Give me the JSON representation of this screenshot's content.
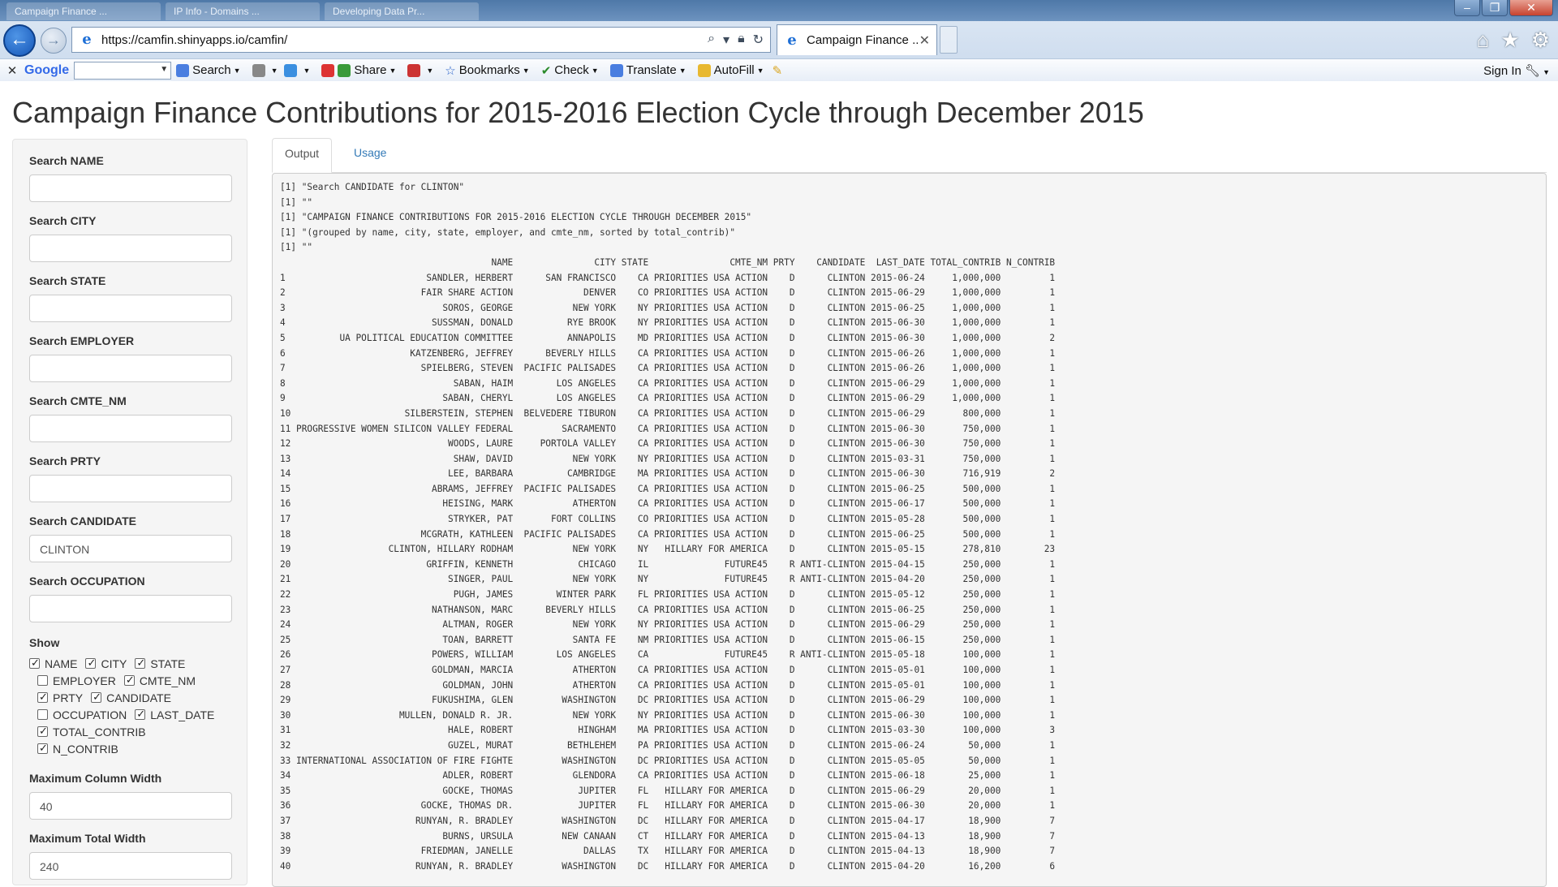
{
  "browser": {
    "bg_tabs": [
      "Campaign Finance ...",
      "IP Info - Domains ...",
      "Developing Data Pr..."
    ],
    "url": "https://camfin.shinyapps.io/camfin/",
    "active_tab_title": "Campaign Finance ...",
    "toolbar": {
      "google": "Google",
      "search": "Search",
      "share": "Share",
      "bookmarks": "Bookmarks",
      "check": "Check",
      "translate": "Translate",
      "autofill": "AutoFill",
      "sign_in": "Sign In"
    }
  },
  "page": {
    "title": "Campaign Finance Contributions for 2015-2016 Election Cycle through December 2015"
  },
  "sidebar": {
    "fields": [
      {
        "label": "Search NAME",
        "value": ""
      },
      {
        "label": "Search CITY",
        "value": ""
      },
      {
        "label": "Search STATE",
        "value": ""
      },
      {
        "label": "Search EMPLOYER",
        "value": ""
      },
      {
        "label": "Search CMTE_NM",
        "value": ""
      },
      {
        "label": "Search PRTY",
        "value": ""
      },
      {
        "label": "Search CANDIDATE",
        "value": "CLINTON"
      },
      {
        "label": "Search OCCUPATION",
        "value": ""
      }
    ],
    "show_label": "Show",
    "show": [
      [
        {
          "label": "NAME",
          "checked": true
        },
        {
          "label": "CITY",
          "checked": true
        },
        {
          "label": "STATE",
          "checked": true
        }
      ],
      [
        {
          "label": "EMPLOYER",
          "checked": false
        },
        {
          "label": "CMTE_NM",
          "checked": true
        }
      ],
      [
        {
          "label": "PRTY",
          "checked": true
        },
        {
          "label": "CANDIDATE",
          "checked": true
        }
      ],
      [
        {
          "label": "OCCUPATION",
          "checked": false
        },
        {
          "label": "LAST_DATE",
          "checked": true
        }
      ],
      [
        {
          "label": "TOTAL_CONTRIB",
          "checked": true
        }
      ],
      [
        {
          "label": "N_CONTRIB",
          "checked": true
        }
      ]
    ],
    "max_col_width": {
      "label": "Maximum Column Width",
      "value": "40"
    },
    "max_total_width": {
      "label": "Maximum Total Width",
      "value": "240"
    }
  },
  "tabs": [
    {
      "label": "Output",
      "active": true
    },
    {
      "label": "Usage",
      "active": false
    }
  ],
  "output": {
    "header_lines": [
      "[1] \"Search CANDIDATE for CLINTON\"",
      "[1] \"\"",
      "[1] \"CAMPAIGN FINANCE CONTRIBUTIONS FOR 2015-2016 ELECTION CYCLE THROUGH DECEMBER 2015\"",
      "[1] \"(grouped by name, city, state, employer, and cmte_nm, sorted by total_contrib)\"",
      "[1] \"\""
    ],
    "columns": [
      "NAME",
      "CITY",
      "STATE",
      "CMTE_NM",
      "PRTY",
      "CANDIDATE",
      "LAST_DATE",
      "TOTAL_CONTRIB",
      "N_CONTRIB"
    ],
    "rows": [
      [
        "SANDLER, HERBERT",
        "SAN FRANCISCO",
        "CA",
        "PRIORITIES USA ACTION",
        "D",
        "CLINTON",
        "2015-06-24",
        "1,000,000",
        "1"
      ],
      [
        "FAIR SHARE ACTION",
        "DENVER",
        "CO",
        "PRIORITIES USA ACTION",
        "D",
        "CLINTON",
        "2015-06-29",
        "1,000,000",
        "1"
      ],
      [
        "SOROS, GEORGE",
        "NEW YORK",
        "NY",
        "PRIORITIES USA ACTION",
        "D",
        "CLINTON",
        "2015-06-25",
        "1,000,000",
        "1"
      ],
      [
        "SUSSMAN, DONALD",
        "RYE BROOK",
        "NY",
        "PRIORITIES USA ACTION",
        "D",
        "CLINTON",
        "2015-06-30",
        "1,000,000",
        "1"
      ],
      [
        "UA POLITICAL EDUCATION COMMITTEE",
        "ANNAPOLIS",
        "MD",
        "PRIORITIES USA ACTION",
        "D",
        "CLINTON",
        "2015-06-30",
        "1,000,000",
        "2"
      ],
      [
        "KATZENBERG, JEFFREY",
        "BEVERLY HILLS",
        "CA",
        "PRIORITIES USA ACTION",
        "D",
        "CLINTON",
        "2015-06-26",
        "1,000,000",
        "1"
      ],
      [
        "SPIELBERG, STEVEN",
        "PACIFIC PALISADES",
        "CA",
        "PRIORITIES USA ACTION",
        "D",
        "CLINTON",
        "2015-06-26",
        "1,000,000",
        "1"
      ],
      [
        "SABAN, HAIM",
        "LOS ANGELES",
        "CA",
        "PRIORITIES USA ACTION",
        "D",
        "CLINTON",
        "2015-06-29",
        "1,000,000",
        "1"
      ],
      [
        "SABAN, CHERYL",
        "LOS ANGELES",
        "CA",
        "PRIORITIES USA ACTION",
        "D",
        "CLINTON",
        "2015-06-29",
        "1,000,000",
        "1"
      ],
      [
        "SILBERSTEIN, STEPHEN",
        "BELVEDERE TIBURON",
        "CA",
        "PRIORITIES USA ACTION",
        "D",
        "CLINTON",
        "2015-06-29",
        "800,000",
        "1"
      ],
      [
        "PROGRESSIVE WOMEN SILICON VALLEY FEDERAL",
        "SACRAMENTO",
        "CA",
        "PRIORITIES USA ACTION",
        "D",
        "CLINTON",
        "2015-06-30",
        "750,000",
        "1"
      ],
      [
        "WOODS, LAURE",
        "PORTOLA VALLEY",
        "CA",
        "PRIORITIES USA ACTION",
        "D",
        "CLINTON",
        "2015-06-30",
        "750,000",
        "1"
      ],
      [
        "SHAW, DAVID",
        "NEW YORK",
        "NY",
        "PRIORITIES USA ACTION",
        "D",
        "CLINTON",
        "2015-03-31",
        "750,000",
        "1"
      ],
      [
        "LEE, BARBARA",
        "CAMBRIDGE",
        "MA",
        "PRIORITIES USA ACTION",
        "D",
        "CLINTON",
        "2015-06-30",
        "716,919",
        "2"
      ],
      [
        "ABRAMS, JEFFREY",
        "PACIFIC PALISADES",
        "CA",
        "PRIORITIES USA ACTION",
        "D",
        "CLINTON",
        "2015-06-25",
        "500,000",
        "1"
      ],
      [
        "HEISING, MARK",
        "ATHERTON",
        "CA",
        "PRIORITIES USA ACTION",
        "D",
        "CLINTON",
        "2015-06-17",
        "500,000",
        "1"
      ],
      [
        "STRYKER, PAT",
        "FORT COLLINS",
        "CO",
        "PRIORITIES USA ACTION",
        "D",
        "CLINTON",
        "2015-05-28",
        "500,000",
        "1"
      ],
      [
        "MCGRATH, KATHLEEN",
        "PACIFIC PALISADES",
        "CA",
        "PRIORITIES USA ACTION",
        "D",
        "CLINTON",
        "2015-06-25",
        "500,000",
        "1"
      ],
      [
        "CLINTON, HILLARY RODHAM",
        "NEW YORK",
        "NY",
        "HILLARY FOR AMERICA",
        "D",
        "CLINTON",
        "2015-05-15",
        "278,810",
        "23"
      ],
      [
        "GRIFFIN, KENNETH",
        "CHICAGO",
        "IL",
        "FUTURE45",
        "R",
        "ANTI-CLINTON",
        "2015-04-15",
        "250,000",
        "1"
      ],
      [
        "SINGER, PAUL",
        "NEW YORK",
        "NY",
        "FUTURE45",
        "R",
        "ANTI-CLINTON",
        "2015-04-20",
        "250,000",
        "1"
      ],
      [
        "PUGH, JAMES",
        "WINTER PARK",
        "FL",
        "PRIORITIES USA ACTION",
        "D",
        "CLINTON",
        "2015-05-12",
        "250,000",
        "1"
      ],
      [
        "NATHANSON, MARC",
        "BEVERLY HILLS",
        "CA",
        "PRIORITIES USA ACTION",
        "D",
        "CLINTON",
        "2015-06-25",
        "250,000",
        "1"
      ],
      [
        "ALTMAN, ROGER",
        "NEW YORK",
        "NY",
        "PRIORITIES USA ACTION",
        "D",
        "CLINTON",
        "2015-06-29",
        "250,000",
        "1"
      ],
      [
        "TOAN, BARRETT",
        "SANTA FE",
        "NM",
        "PRIORITIES USA ACTION",
        "D",
        "CLINTON",
        "2015-06-15",
        "250,000",
        "1"
      ],
      [
        "POWERS, WILLIAM",
        "LOS ANGELES",
        "CA",
        "FUTURE45",
        "R",
        "ANTI-CLINTON",
        "2015-05-18",
        "100,000",
        "1"
      ],
      [
        "GOLDMAN, MARCIA",
        "ATHERTON",
        "CA",
        "PRIORITIES USA ACTION",
        "D",
        "CLINTON",
        "2015-05-01",
        "100,000",
        "1"
      ],
      [
        "GOLDMAN, JOHN",
        "ATHERTON",
        "CA",
        "PRIORITIES USA ACTION",
        "D",
        "CLINTON",
        "2015-05-01",
        "100,000",
        "1"
      ],
      [
        "FUKUSHIMA, GLEN",
        "WASHINGTON",
        "DC",
        "PRIORITIES USA ACTION",
        "D",
        "CLINTON",
        "2015-06-29",
        "100,000",
        "1"
      ],
      [
        "MULLEN, DONALD R. JR.",
        "NEW YORK",
        "NY",
        "PRIORITIES USA ACTION",
        "D",
        "CLINTON",
        "2015-06-30",
        "100,000",
        "1"
      ],
      [
        "HALE, ROBERT",
        "HINGHAM",
        "MA",
        "PRIORITIES USA ACTION",
        "D",
        "CLINTON",
        "2015-03-30",
        "100,000",
        "3"
      ],
      [
        "GUZEL, MURAT",
        "BETHLEHEM",
        "PA",
        "PRIORITIES USA ACTION",
        "D",
        "CLINTON",
        "2015-06-24",
        "50,000",
        "1"
      ],
      [
        "INTERNATIONAL ASSOCIATION OF FIRE FIGHTE",
        "WASHINGTON",
        "DC",
        "PRIORITIES USA ACTION",
        "D",
        "CLINTON",
        "2015-05-05",
        "50,000",
        "1"
      ],
      [
        "ADLER, ROBERT",
        "GLENDORA",
        "CA",
        "PRIORITIES USA ACTION",
        "D",
        "CLINTON",
        "2015-06-18",
        "25,000",
        "1"
      ],
      [
        "GOCKE, THOMAS",
        "JUPITER",
        "FL",
        "HILLARY FOR AMERICA",
        "D",
        "CLINTON",
        "2015-06-29",
        "20,000",
        "1"
      ],
      [
        "GOCKE, THOMAS DR.",
        "JUPITER",
        "FL",
        "HILLARY FOR AMERICA",
        "D",
        "CLINTON",
        "2015-06-30",
        "20,000",
        "1"
      ],
      [
        "RUNYAN, R. BRADLEY",
        "WASHINGTON",
        "DC",
        "HILLARY FOR AMERICA",
        "D",
        "CLINTON",
        "2015-04-17",
        "18,900",
        "7"
      ],
      [
        "BURNS, URSULA",
        "NEW CANAAN",
        "CT",
        "HILLARY FOR AMERICA",
        "D",
        "CLINTON",
        "2015-04-13",
        "18,900",
        "7"
      ],
      [
        "FRIEDMAN, JANELLE",
        "DALLAS",
        "TX",
        "HILLARY FOR AMERICA",
        "D",
        "CLINTON",
        "2015-04-13",
        "18,900",
        "7"
      ],
      [
        "RUNYAN, R. BRADLEY",
        "WASHINGTON",
        "DC",
        "HILLARY FOR AMERICA",
        "D",
        "CLINTON",
        "2015-04-20",
        "16,200",
        "6"
      ]
    ]
  }
}
